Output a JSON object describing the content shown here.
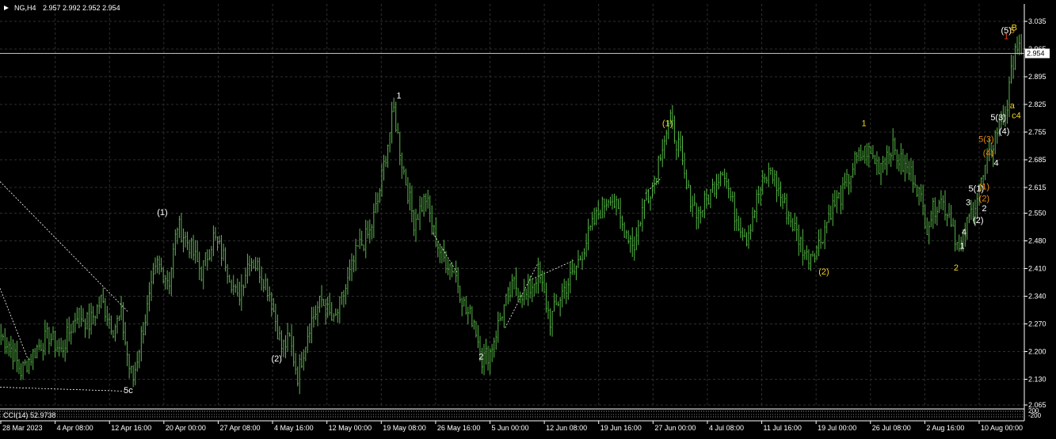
{
  "header": {
    "symbol": "NG,H4",
    "ohlc": "2.957 2.992 2.952 2.954",
    "indicator": "CCI(14) 52.9738"
  },
  "colors": {
    "background": "#000000",
    "grid": "#2e2e2e",
    "candle": "#57b947",
    "axis_text": "#ffffff",
    "wave_white": "#ffffff",
    "wave_yellow": "#f2d21a",
    "wave_orange": "#e38a16",
    "wave_red": "#e04020",
    "trendline": "#ffffff",
    "price_line": "#c0c0c0"
  },
  "chart_data": {
    "type": "candlestick",
    "timeframe": "H4",
    "ylim": [
      2.065,
      3.035
    ],
    "y_ticks": [
      "3.035",
      "2.965",
      "2.895",
      "2.825",
      "2.755",
      "2.685",
      "2.615",
      "2.550",
      "2.480",
      "2.410",
      "2.340",
      "2.270",
      "2.200",
      "2.130",
      "2.065"
    ],
    "x_ticks": [
      "28 Mar 2023",
      "4 Apr 08:00",
      "12 Apr 16:00",
      "20 Apr 00:00",
      "27 Apr 08:00",
      "4 May 16:00",
      "12 May 00:00",
      "19 May 08:00",
      "26 May 16:00",
      "5 Jun 00:00",
      "12 Jun 08:00",
      "19 Jun 16:00",
      "27 Jun 00:00",
      "4 Jul 08:00",
      "11 Jul 16:00",
      "19 Jul 00:00",
      "26 Jul 08:00",
      "2 Aug 16:00",
      "10 Aug 00:00"
    ],
    "current_price": "2.954",
    "indicator_ticks": [
      "200",
      "-200"
    ],
    "swing_path": [
      [
        0,
        2.24
      ],
      [
        4,
        2.22
      ],
      [
        10,
        2.15
      ],
      [
        18,
        2.21
      ],
      [
        24,
        2.24
      ],
      [
        30,
        2.2
      ],
      [
        38,
        2.3
      ],
      [
        44,
        2.27
      ],
      [
        50,
        2.33
      ],
      [
        56,
        2.26
      ],
      [
        60,
        2.29
      ],
      [
        64,
        2.16
      ],
      [
        66,
        2.13
      ],
      [
        70,
        2.24
      ],
      [
        78,
        2.42
      ],
      [
        84,
        2.38
      ],
      [
        88,
        2.52
      ],
      [
        94,
        2.47
      ],
      [
        100,
        2.4
      ],
      [
        106,
        2.49
      ],
      [
        112,
        2.43
      ],
      [
        118,
        2.33
      ],
      [
        124,
        2.44
      ],
      [
        130,
        2.4
      ],
      [
        134,
        2.35
      ],
      [
        140,
        2.21
      ],
      [
        144,
        2.23
      ],
      [
        148,
        2.14
      ],
      [
        154,
        2.27
      ],
      [
        160,
        2.33
      ],
      [
        166,
        2.27
      ],
      [
        172,
        2.36
      ],
      [
        178,
        2.46
      ],
      [
        184,
        2.5
      ],
      [
        188,
        2.58
      ],
      [
        192,
        2.7
      ],
      [
        196,
        2.81
      ],
      [
        200,
        2.68
      ],
      [
        206,
        2.53
      ],
      [
        212,
        2.59
      ],
      [
        216,
        2.5
      ],
      [
        220,
        2.44
      ],
      [
        226,
        2.41
      ],
      [
        232,
        2.3
      ],
      [
        236,
        2.28
      ],
      [
        240,
        2.18
      ],
      [
        244,
        2.2
      ],
      [
        250,
        2.3
      ],
      [
        256,
        2.37
      ],
      [
        262,
        2.34
      ],
      [
        268,
        2.4
      ],
      [
        274,
        2.28
      ],
      [
        280,
        2.35
      ],
      [
        286,
        2.4
      ],
      [
        292,
        2.48
      ],
      [
        298,
        2.55
      ],
      [
        304,
        2.6
      ],
      [
        310,
        2.52
      ],
      [
        316,
        2.47
      ],
      [
        320,
        2.56
      ],
      [
        326,
        2.64
      ],
      [
        330,
        2.73
      ],
      [
        334,
        2.78
      ],
      [
        338,
        2.72
      ],
      [
        342,
        2.61
      ],
      [
        348,
        2.55
      ],
      [
        354,
        2.6
      ],
      [
        360,
        2.67
      ],
      [
        366,
        2.55
      ],
      [
        372,
        2.49
      ],
      [
        378,
        2.6
      ],
      [
        384,
        2.66
      ],
      [
        390,
        2.58
      ],
      [
        396,
        2.51
      ],
      [
        402,
        2.44
      ],
      [
        408,
        2.47
      ],
      [
        414,
        2.56
      ],
      [
        420,
        2.6
      ],
      [
        426,
        2.68
      ],
      [
        432,
        2.71
      ],
      [
        438,
        2.67
      ],
      [
        444,
        2.72
      ],
      [
        450,
        2.67
      ],
      [
        456,
        2.64
      ],
      [
        462,
        2.52
      ],
      [
        468,
        2.59
      ],
      [
        474,
        2.54
      ],
      [
        478,
        2.45
      ],
      [
        482,
        2.52
      ],
      [
        486,
        2.58
      ],
      [
        490,
        2.64
      ],
      [
        494,
        2.71
      ],
      [
        498,
        2.78
      ],
      [
        502,
        2.82
      ],
      [
        506,
        2.98
      ],
      [
        509,
        2.955
      ]
    ],
    "trendlines": [
      [
        [
          0,
          2.63
        ],
        [
          64,
          2.3
        ]
      ],
      [
        [
          0,
          2.36
        ],
        [
          14,
          2.18
        ]
      ],
      [
        [
          0,
          2.11
        ],
        [
          62,
          2.1
        ]
      ],
      [
        [
          216,
          2.5
        ],
        [
          228,
          2.4
        ]
      ],
      [
        [
          252,
          2.26
        ],
        [
          268,
          2.42
        ]
      ],
      [
        [
          264,
          2.38
        ],
        [
          286,
          2.43
        ]
      ],
      [
        [
          322,
          2.6
        ],
        [
          330,
          2.64
        ]
      ]
    ],
    "wave_labels": [
      {
        "text": "5c",
        "x": 64,
        "y": 2.095,
        "color": "white"
      },
      {
        "text": "(1)",
        "x": 81,
        "y": 2.545,
        "color": "white"
      },
      {
        "text": "(2)",
        "x": 138,
        "y": 2.175,
        "color": "white"
      },
      {
        "text": "1",
        "x": 199,
        "y": 2.84,
        "color": "white"
      },
      {
        "text": "2",
        "x": 240,
        "y": 2.18,
        "color": "white"
      },
      {
        "text": "(1)",
        "x": 333,
        "y": 2.77,
        "color": "yellow"
      },
      {
        "text": "(2)",
        "x": 411,
        "y": 2.395,
        "color": "yellow"
      },
      {
        "text": "1",
        "x": 431,
        "y": 2.77,
        "color": "yellow"
      },
      {
        "text": "2",
        "x": 477,
        "y": 2.405,
        "color": "yellow"
      },
      {
        "text": "1",
        "x": 480,
        "y": 2.46,
        "color": "white"
      },
      {
        "text": "4",
        "x": 481,
        "y": 2.495,
        "color": "white"
      },
      {
        "text": "3",
        "x": 483,
        "y": 2.57,
        "color": "white"
      },
      {
        "text": "(2)",
        "x": 488,
        "y": 2.525,
        "color": "white"
      },
      {
        "text": "5(1)",
        "x": 487,
        "y": 2.605,
        "color": "white"
      },
      {
        "text": "2",
        "x": 491,
        "y": 2.555,
        "color": "white"
      },
      {
        "text": "(2)",
        "x": 491,
        "y": 2.58,
        "color": "orange"
      },
      {
        "text": "(1)",
        "x": 491,
        "y": 2.61,
        "color": "orange"
      },
      {
        "text": "4",
        "x": 497,
        "y": 2.67,
        "color": "white"
      },
      {
        "text": "(4)",
        "x": 493,
        "y": 2.695,
        "color": "orange"
      },
      {
        "text": "5(3)",
        "x": 492,
        "y": 2.73,
        "color": "orange"
      },
      {
        "text": "(4)",
        "x": 501,
        "y": 2.75,
        "color": "white"
      },
      {
        "text": "5(3)",
        "x": 498,
        "y": 2.785,
        "color": "white"
      },
      {
        "text": "c4",
        "x": 507,
        "y": 2.79,
        "color": "yellow"
      },
      {
        "text": "a",
        "x": 505,
        "y": 2.815,
        "color": "yellow"
      },
      {
        "text": "(5)",
        "x": 502,
        "y": 3.005,
        "color": "white"
      },
      {
        "text": "1",
        "x": 502,
        "y": 2.99,
        "color": "red"
      },
      {
        "text": "5",
        "x": 505,
        "y": 3.005,
        "color": "orange"
      },
      {
        "text": "B",
        "x": 506,
        "y": 3.012,
        "color": "yellow"
      }
    ]
  }
}
